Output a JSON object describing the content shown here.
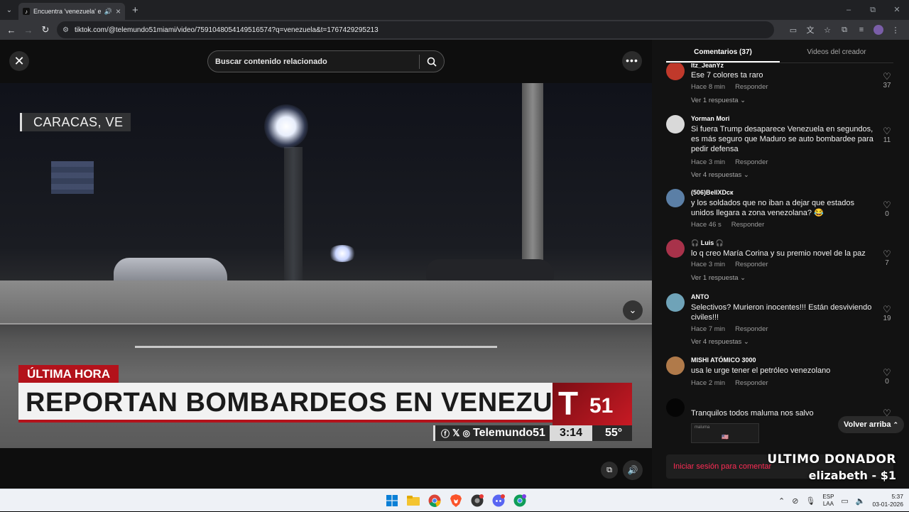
{
  "browser": {
    "tab_title": "Encuentra 'venezuela' en TikTok",
    "url": "tiktok.com/@telemundo51miami/video/7591048054149516574?q=venezuela&t=1767429295213",
    "new_tab": "+",
    "minimize": "–",
    "restore": "⧉",
    "close": "✕"
  },
  "video_page": {
    "search_placeholder": "Buscar contenido relacionado",
    "close_glyph": "✕",
    "more_glyph": "•••",
    "down_glyph": "⌄"
  },
  "video": {
    "location": "CARACAS, VE",
    "breaking": "ÚLTIMA HORA",
    "headline": "REPORTAN BOMBARDEOS EN VENEZUELA",
    "channel": "Telemundo51",
    "time": "3:14",
    "temperature": "55°",
    "logo_number": "51"
  },
  "panel": {
    "tabs": [
      {
        "label": "Comentarios (37)",
        "active": true
      },
      {
        "label": "Videos del creador",
        "active": false
      }
    ],
    "reply_label": "Responder",
    "back_to_top": "Volver arriba",
    "login_prompt": "Iniciar sesión para comentar",
    "thumb_flag": "🇺🇸",
    "thumb_label": "maluma",
    "comments": [
      {
        "user": "Itz_JeanYz",
        "text": "Ese 7 colores ta raro",
        "time": "Hace 8 min",
        "likes": "37",
        "replies": "Ver 1 respuesta ⌄",
        "avatar_color": "#c0392b"
      },
      {
        "user": "Yorman Mori",
        "text": "Si fuera Trump desaparece Venezuela en segundos, es más seguro que Maduro se auto bombardee para pedir defensa",
        "time": "Hace 3 min",
        "likes": "11",
        "replies": "Ver 4 respuestas ⌄",
        "avatar_color": "#d9d9d9"
      },
      {
        "user": "(506)BellXDcк",
        "text": "y los soldados que no iban a dejar que estados unidos llegara a zona venezolana? 😂",
        "time": "Hace 46 s",
        "likes": "0",
        "replies": "",
        "avatar_color": "#5b7fa6"
      },
      {
        "user": "🎧 Luis 🎧",
        "text": "lo q creo María Corina y su premio novel de la paz",
        "time": "Hace 3 min",
        "likes": "7",
        "replies": "Ver 1 respuesta ⌄",
        "avatar_color": "#a8324a"
      },
      {
        "user": "ANTO",
        "text": "Selectivos? Murieron inocentes!!! Están desviviendo civiles!!!",
        "time": "Hace 7 min",
        "likes": "19",
        "replies": "Ver 4 respuestas ⌄",
        "avatar_color": "#6fa3b8"
      },
      {
        "user": "MISHI ATÓMICO 3000",
        "text": "usa le urge tener el petróleo venezolano",
        "time": "Hace 2 min",
        "likes": "0",
        "replies": "",
        "avatar_color": "#b07a4a"
      },
      {
        "user": "",
        "text": "Tranquilos todos maluma nos salvo",
        "time": "",
        "likes": "",
        "replies": "",
        "avatar_color": "#050505"
      }
    ]
  },
  "overlay": {
    "donor_title": "ULTIMO DONADOR",
    "donor_name": "elizabeth - $1"
  },
  "taskbar": {
    "language": "ESP",
    "layout": "LAA",
    "time": "5:37",
    "date": "03-01-2026"
  }
}
